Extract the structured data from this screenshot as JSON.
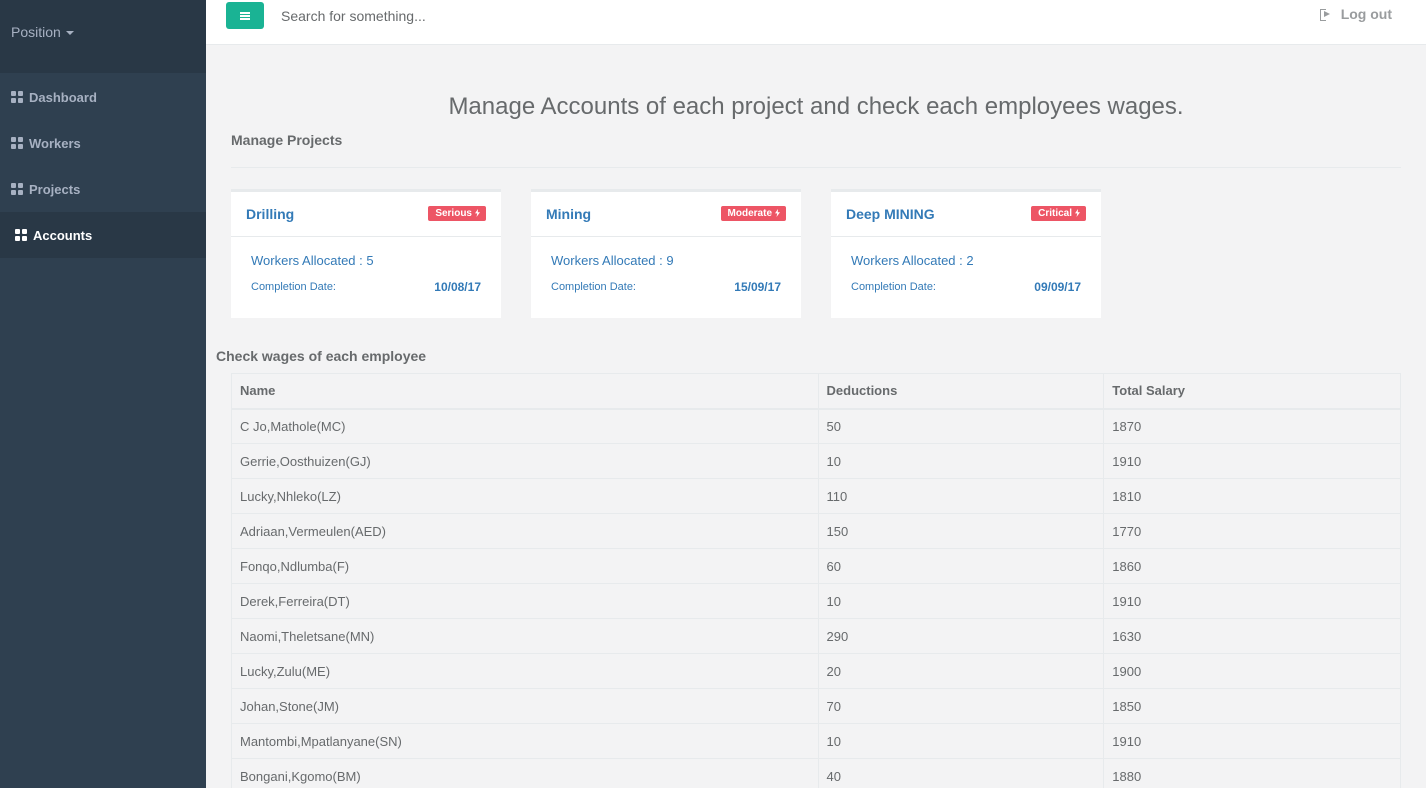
{
  "sidebar": {
    "position_label": "Position",
    "items": [
      {
        "label": "Dashboard",
        "icon": "th-large-icon"
      },
      {
        "label": "Workers",
        "icon": "th-large-icon"
      },
      {
        "label": "Projects",
        "icon": "th-large-icon"
      },
      {
        "label": "Accounts",
        "icon": "th-large-icon",
        "active": true
      }
    ]
  },
  "topbar": {
    "search_placeholder": "Search for something...",
    "logout_label": "Log out"
  },
  "main": {
    "heading": "Manage Accounts of each project and check each employees wages.",
    "projects_title": "Manage Projects",
    "projects": [
      {
        "name": "Drilling",
        "badge": "Serious",
        "workers": "Workers Allocated : 5",
        "completion_label": "Completion Date:",
        "completion_date": "10/08/17"
      },
      {
        "name": "Mining",
        "badge": "Moderate",
        "workers": "Workers Allocated : 9",
        "completion_label": "Completion Date:",
        "completion_date": "15/09/17"
      },
      {
        "name": "Deep MINING",
        "badge": "Critical",
        "workers": "Workers Allocated : 2",
        "completion_label": "Completion Date:",
        "completion_date": "09/09/17"
      }
    ],
    "wages_title": "Check wages of each employee",
    "table": {
      "headers": [
        "Name",
        "Deductions",
        "Total Salary"
      ],
      "rows": [
        [
          "C Jo,Mathole(MC)",
          "50",
          "1870"
        ],
        [
          "Gerrie,Oosthuizen(GJ)",
          "10",
          "1910"
        ],
        [
          "Lucky,Nhleko(LZ)",
          "110",
          "1810"
        ],
        [
          "Adriaan,Vermeulen(AED)",
          "150",
          "1770"
        ],
        [
          "Fonqo,Ndlumba(F)",
          "60",
          "1860"
        ],
        [
          "Derek,Ferreira(DT)",
          "10",
          "1910"
        ],
        [
          "Naomi,Theletsane(MN)",
          "290",
          "1630"
        ],
        [
          "Lucky,Zulu(ME)",
          "20",
          "1900"
        ],
        [
          "Johan,Stone(JM)",
          "70",
          "1850"
        ],
        [
          "Mantombi,Mpatlanyane(SN)",
          "10",
          "1910"
        ],
        [
          "Bongani,Kgomo(BM)",
          "40",
          "1880"
        ]
      ]
    }
  },
  "colors": {
    "sidebar_bg": "#2f4050",
    "accent": "#1ab394",
    "link": "#337ab7",
    "danger": "#ed5565"
  }
}
